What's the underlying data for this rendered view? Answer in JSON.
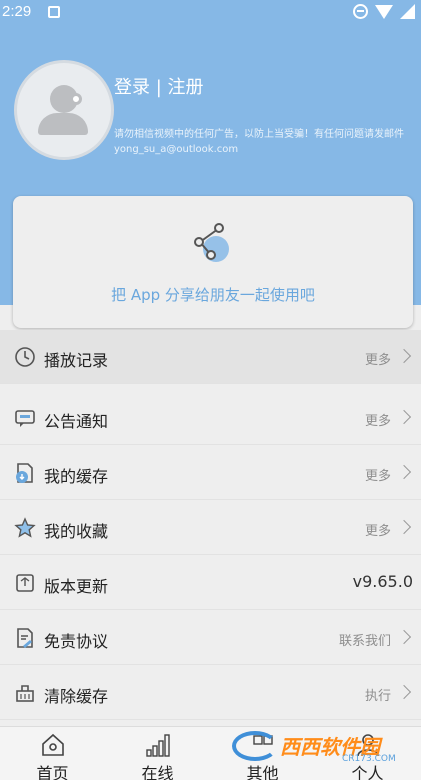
{
  "status_bar": {
    "time": "2:29"
  },
  "profile": {
    "login_label": "登录 | 注册",
    "notice": "请勿相信视频中的任何广告，以防上当受骗！有任何问题请发邮件 yong_su_a@outlook.com"
  },
  "share": {
    "text": "把 App 分享给朋友一起使用吧"
  },
  "menu": {
    "items": [
      {
        "icon": "history-clock-icon",
        "label": "播放记录",
        "action": "更多"
      },
      {
        "icon": "announcement-icon",
        "label": "公告通知",
        "action": "更多"
      },
      {
        "icon": "download-cache-icon",
        "label": "我的缓存",
        "action": "更多"
      },
      {
        "icon": "star-icon",
        "label": "我的收藏",
        "action": "更多"
      },
      {
        "icon": "update-icon",
        "label": "版本更新",
        "value": "v9.65.0"
      },
      {
        "icon": "disclaimer-icon",
        "label": "免责协议",
        "action": "联系我们"
      },
      {
        "icon": "clear-cache-icon",
        "label": "清除缓存",
        "action": "执行"
      }
    ]
  },
  "tabs": [
    {
      "icon": "home-icon",
      "label": "首页"
    },
    {
      "icon": "signal-bars-icon",
      "label": "在线"
    },
    {
      "icon": "other-icon",
      "label": "其他"
    },
    {
      "icon": "person-icon",
      "label": "个人"
    }
  ],
  "watermark": {
    "text": "西西软件园",
    "sub": "CR173.COM"
  },
  "colors": {
    "header": "#86b8e6",
    "accent": "#6aa7dd",
    "background": "#eeeeee"
  }
}
